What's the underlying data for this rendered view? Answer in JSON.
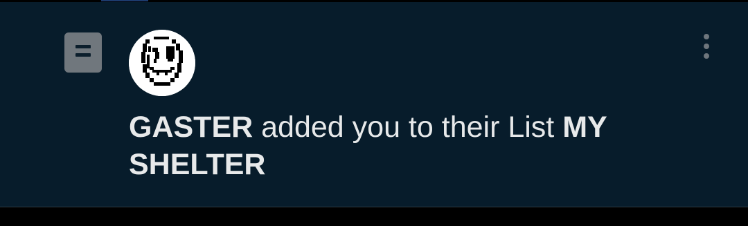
{
  "notification": {
    "type_icon": "list-icon",
    "avatar_icon": "gaster-face-avatar",
    "menu_icon": "more-vertical-icon",
    "actor_name": "GASTER",
    "action_text": "added you to their List",
    "list_name": "MY SHELTER"
  },
  "colors": {
    "background": "#071c2b",
    "text": "#e7e9ea",
    "icon_gray": "#70777d"
  }
}
